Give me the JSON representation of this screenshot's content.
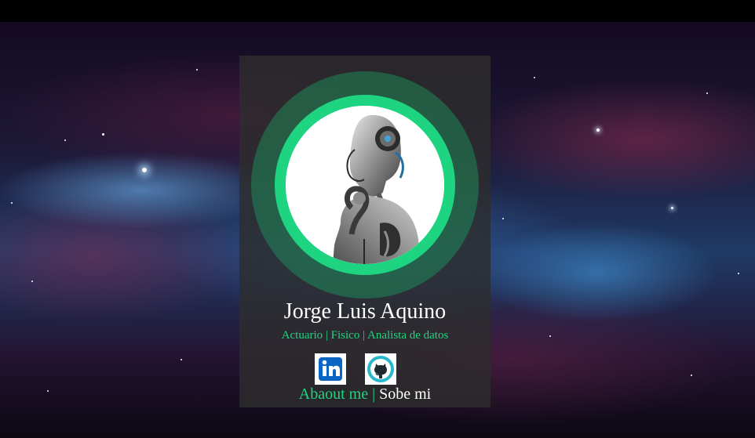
{
  "profile": {
    "name": "Jorge Luis Aquino",
    "roles": "Actuario | Fisico | Analista de datos"
  },
  "social": {
    "linkedin_icon": "linkedin-icon",
    "github_icon": "github-icon"
  },
  "footer_links": {
    "about_en": "Abaout me",
    "separator": "|",
    "about_es": "Sobe mi"
  },
  "colors": {
    "accent": "#1ed481",
    "card_background": "#2d2d2d",
    "linkedin_blue": "#0a66c2",
    "github_teal": "#2ab7c9"
  }
}
